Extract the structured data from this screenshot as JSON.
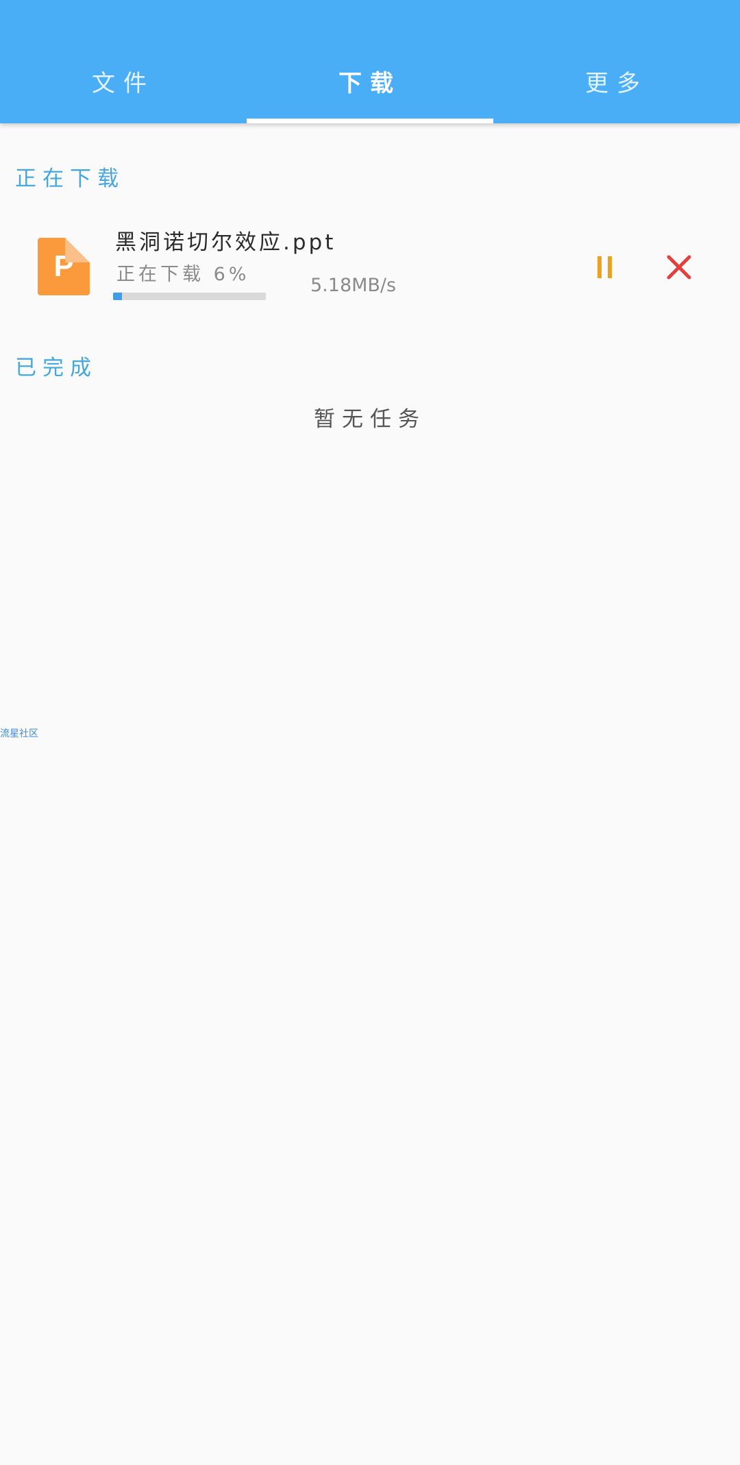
{
  "tabs": [
    {
      "label": "文件"
    },
    {
      "label": "下载"
    },
    {
      "label": "更多"
    }
  ],
  "active_tab_index": 1,
  "downloading": {
    "title": "正在下载",
    "item": {
      "icon": "ppt-file-icon",
      "icon_letter": "P",
      "icon_color": "#fa9a3c",
      "name": "黑洞诺切尔效应.ppt",
      "status": "正在下载 6%",
      "progress": 0.06,
      "speed": "5.18MB/s",
      "pause_icon": "pause-icon",
      "pause_color": "#e8a323",
      "cancel_icon": "close-icon",
      "cancel_color": "#e3403d"
    }
  },
  "completed": {
    "title": "已完成",
    "empty_text": "暂无任务"
  },
  "watermark": "流星社区",
  "colors": {
    "appbar": "#4aaef6",
    "section_title": "#45a7dc",
    "progress": "#3c9ee8"
  }
}
